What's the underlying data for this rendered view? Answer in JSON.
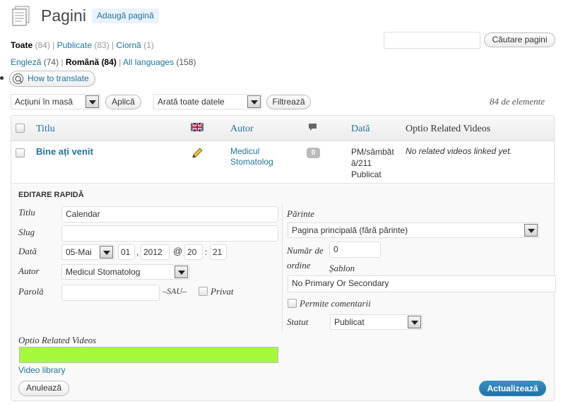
{
  "header": {
    "title": "Pagini",
    "add_button": "Adaugă pagină"
  },
  "filters": {
    "all_label": "Toate",
    "all_count": "(84)",
    "published_label": "Publicate",
    "published_count": "(83)",
    "draft_label": "Ciornă",
    "draft_count": "(1)",
    "sep": "|"
  },
  "languages": {
    "en_label": "Engleză",
    "en_count": "(74)",
    "ro_label": "Română",
    "ro_count": "(84)",
    "all_label": "All languages",
    "all_count": "(158)"
  },
  "search": {
    "placeholder": "",
    "button": "Căutare pagini"
  },
  "translate_button": "How to translate",
  "toolbar": {
    "bulk_select": "Acțiuni în masă",
    "apply": "Aplică",
    "dates_select": "Arată toate datele",
    "filter": "Filtrează",
    "count": "84 de elemente"
  },
  "table": {
    "headers": {
      "title": "Titlu",
      "author": "Autor",
      "date": "Dată",
      "related": "Optio Related Videos"
    },
    "row": {
      "title": "Bine ați venit",
      "author_line1": "Medicul",
      "author_line2": "Stomatolog",
      "comments": "0",
      "date_line1": "PM/sâmbăt",
      "date_line2": "ă/211",
      "date_line3": "Publicat",
      "related": "No related videos linked yet."
    }
  },
  "quick_edit": {
    "heading": "EDITARE RAPIDĂ",
    "title_label": "Titlu",
    "title_value": "Calendar",
    "slug_label": "Slug",
    "slug_value": "",
    "date_label": "Dată",
    "month": "05-Mai",
    "day": "01",
    "comma": ",",
    "year": "2012",
    "at": "@",
    "hour": "20",
    "colon": ":",
    "minute": "21",
    "author_label": "Autor",
    "author_value": "Medicul Stomatolog",
    "password_label": "Parolă",
    "password_value": "",
    "or_label": "–SAU–",
    "private_label": "Privat",
    "parent_label": "Părinte",
    "parent_value": "Pagina principală (fără părinte)",
    "order_label_1": "Număr de",
    "order_label_2": "ordine",
    "order_value": "0",
    "template_label": "Șablon",
    "template_value": "No Primary Or Secondary",
    "comments_label": "Permite comentarii",
    "status_label": "Statut",
    "status_value": "Publicat",
    "related_label": "Optio Related Videos",
    "related_bar_color": "#a6f93a",
    "video_library": "Video library",
    "cancel": "Anulează",
    "update": "Actualizează"
  },
  "colors": {
    "link": "#21759b",
    "primary": "#2e7fbb"
  }
}
